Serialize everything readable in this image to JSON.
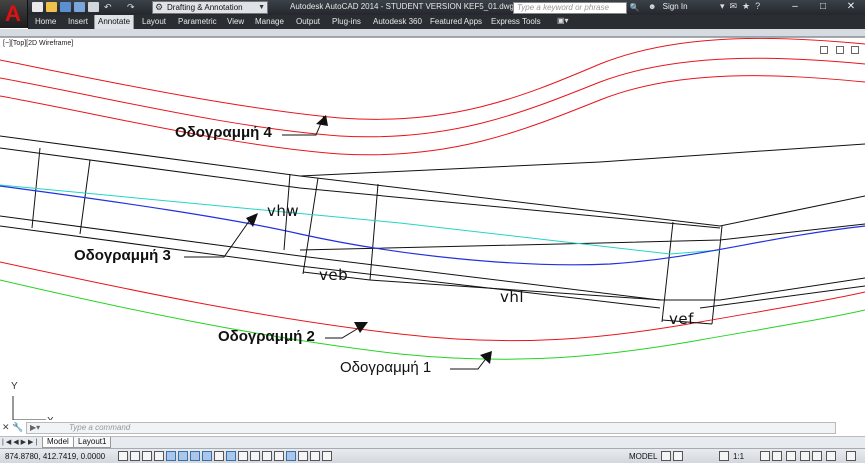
{
  "title_bar": {
    "workspace": "Drafting & Annotation",
    "title": "Autodesk AutoCAD 2014 - STUDENT VERSION    KEF5_01.dwg",
    "search_placeholder": "Type a keyword or phrase",
    "sign_in": "Sign In"
  },
  "ribbon_tabs": [
    "Home",
    "Insert",
    "Annotate",
    "Layout",
    "Parametric",
    "View",
    "Manage",
    "Output",
    "Plug-ins",
    "Autodesk 360",
    "Featured Apps",
    "Express Tools"
  ],
  "active_tab": "Annotate",
  "viewport": {
    "label": "[−][Top][2D Wireframe]"
  },
  "drawing": {
    "labels": {
      "road_line_4": "Οδογραμμή 4",
      "road_line_3": "Οδογραμμή 3",
      "road_line_2": "Οδογραμμή 2",
      "road_line_1": "Οδογραμμή 1"
    },
    "dimensions": {
      "vhw": "vhw",
      "veb": "veb",
      "vhl": "vhl",
      "vef": "vef"
    },
    "colors": {
      "red": "#e8141c",
      "green": "#22d422",
      "cyan": "#21d6c6",
      "blue": "#2230e0",
      "black": "#111111"
    },
    "ucs": {
      "y": "Y",
      "x": "X"
    }
  },
  "command_line": {
    "placeholder": "Type a command"
  },
  "layout_tabs": [
    "Model",
    "Layout1"
  ],
  "status_bar": {
    "coordinates": "874.8780, 412.7419, 0.0000",
    "mode": "MODEL",
    "scale": "1:1"
  }
}
